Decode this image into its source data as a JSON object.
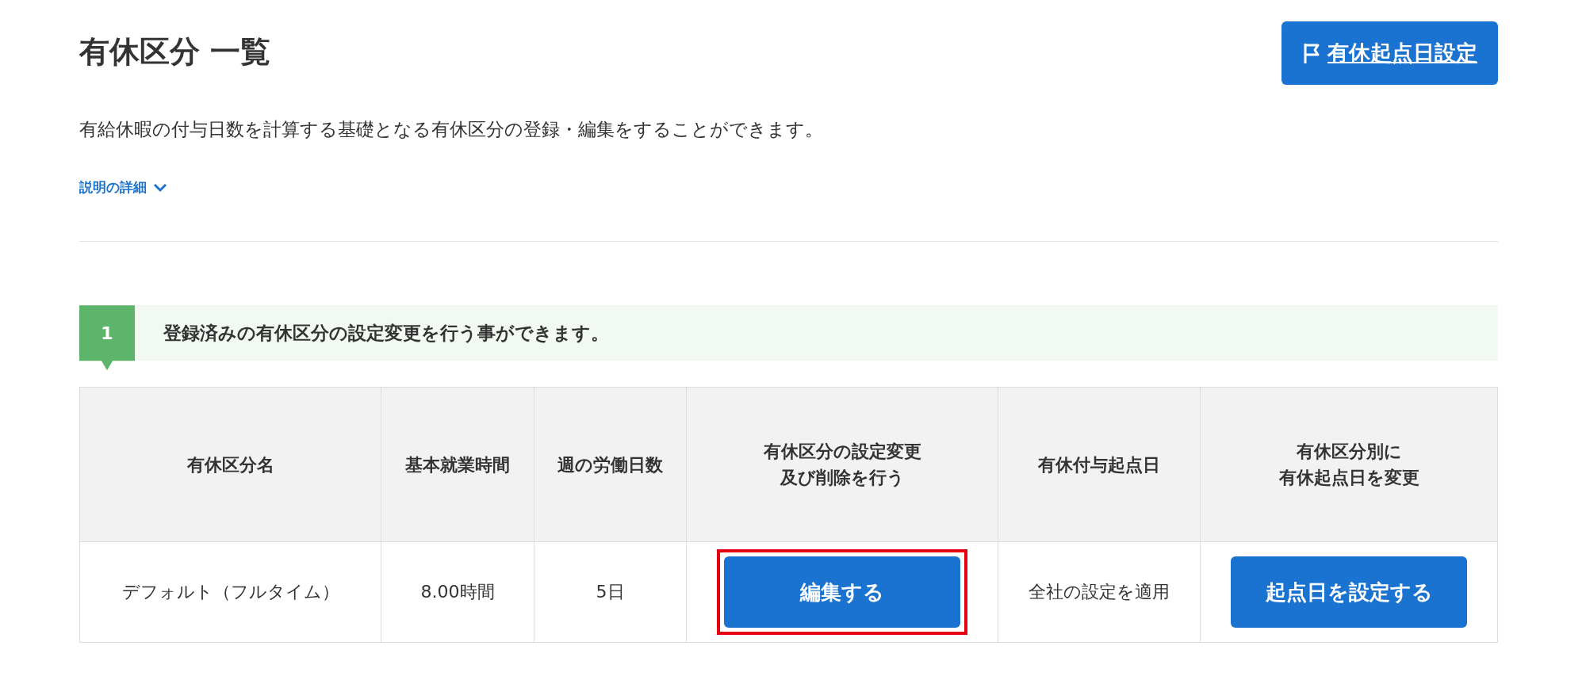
{
  "header": {
    "title": "有休区分 一覧",
    "action_button": {
      "label": "有休起点日設定"
    }
  },
  "description": "有給休暇の付与日数を計算する基礎となる有休区分の登録・編集をすることができます。",
  "details_toggle": {
    "label": "説明の詳細",
    "expanded": false
  },
  "step": {
    "number": "1",
    "text": "登録済みの有休区分の設定変更を行う事ができます。"
  },
  "table": {
    "columns": [
      {
        "lines": [
          "有休区分名"
        ]
      },
      {
        "lines": [
          "基本就業時間"
        ]
      },
      {
        "lines": [
          "週の労働日数"
        ]
      },
      {
        "lines": [
          "有休区分の設定変更",
          "及び削除を行う"
        ]
      },
      {
        "lines": [
          "有休付与起点日"
        ]
      },
      {
        "lines": [
          "有休区分別に",
          "有休起点日を変更"
        ]
      }
    ],
    "rows": [
      {
        "cells": [
          {
            "kind": "text",
            "text": "デフォルト（フルタイム）"
          },
          {
            "kind": "text",
            "text": "8.00時間"
          },
          {
            "kind": "text",
            "text": "5日"
          },
          {
            "kind": "button",
            "text": "編集する",
            "highlighted": true
          },
          {
            "kind": "text",
            "text": "全社の設定を適用"
          },
          {
            "kind": "button",
            "text": "起点日を設定する",
            "highlighted": false
          }
        ]
      }
    ]
  }
}
